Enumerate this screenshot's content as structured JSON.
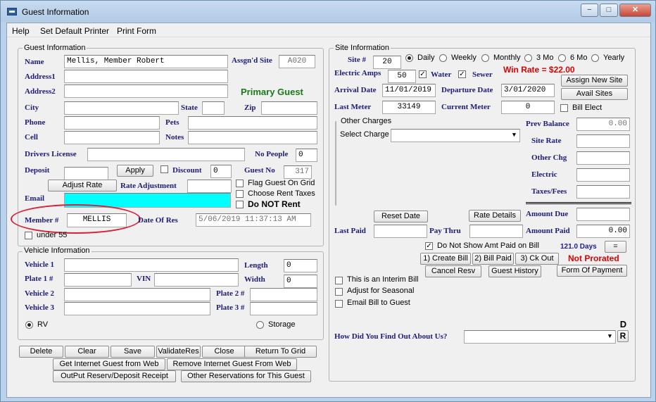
{
  "window": {
    "title": "Guest Information",
    "minimize": "−",
    "maximize": "□",
    "close": "✕"
  },
  "menu": [
    "Help",
    "Set Default Printer",
    "Print Form"
  ],
  "guest": {
    "legend": "Guest Information",
    "name_label": "Name",
    "name_value": "Mellis, Member Robert",
    "assgnd_site_label": "Assgn'd Site",
    "assgnd_site_value": "A020",
    "address1_label": "Address1",
    "address2_label": "Address2",
    "primary_guest": "Primary Guest",
    "city_label": "City",
    "state_label": "State",
    "zip_label": "Zip",
    "phone_label": "Phone",
    "pets_label": "Pets",
    "cell_label": "Cell",
    "notes_label": "Notes",
    "drivers_license_label": "Drivers License",
    "no_people_label": "No People",
    "no_people_value": "0",
    "deposit_label": "Deposit",
    "apply_button": "Apply",
    "discount_label": "Discount",
    "discount_value": "0",
    "guest_no_label": "Guest No",
    "guest_no_value": "317",
    "adjust_rate_button": "Adjust Rate",
    "rate_adjustment_label": "Rate Adjustment",
    "flag_guest_label": "Flag Guest On Grid",
    "choose_rent_taxes_label": "Choose Rent Taxes",
    "do_not_rent_label": "Do NOT Rent",
    "email_label": "Email",
    "member_label": "Member #",
    "member_value": "MELLIS",
    "date_of_res_label": "Date Of Res",
    "date_of_res_value": "5/06/2019 11:37:13 AM",
    "under55_label": "under 55",
    "accent_color": "#00ffff",
    "circle_color": "#d9203a"
  },
  "vehicle": {
    "legend": "Vehicle Information",
    "vehicle1_label": "Vehicle 1",
    "length_label": "Length",
    "length_value": "0",
    "plate1_label": "Plate 1 #",
    "vin_label": "VIN",
    "width_label": "Width",
    "width_value": "0",
    "vehicle2_label": "Vehicle 2",
    "plate2_label": "Plate 2 #",
    "vehicle3_label": "Vehicle 3",
    "plate3_label": "Plate 3 #",
    "rv_label": "RV",
    "storage_label": "Storage"
  },
  "site": {
    "legend": "Site Information",
    "site_label": "Site #",
    "site_value": "20",
    "daily": "Daily",
    "weekly": "Weekly",
    "monthly": "Monthly",
    "three_mo": "3 Mo",
    "six_mo": "6 Mo",
    "yearly": "Yearly",
    "electric_amps_label": "Electric Amps",
    "electric_amps_value": "50",
    "water_label": "Water",
    "sewer_label": "Sewer",
    "win_rate": "Win Rate = $22.00",
    "assign_new_site_button": "Assign New Site",
    "arrival_date_label": "Arrival Date",
    "arrival_date_value": "11/01/2019",
    "departure_date_label": "Departure Date",
    "departure_date_value": "3/01/2020",
    "avail_sites_button": "Avail Sites",
    "last_meter_label": "Last Meter",
    "last_meter_value": "33149",
    "current_meter_label": "Current Meter",
    "current_meter_value": "0",
    "bill_elect_label": "Bill Elect",
    "other_charges_legend": "Other Charges",
    "select_charge_label": "Select Charge",
    "prev_balance_label": "Prev Balance",
    "prev_balance_value": "0.00",
    "site_rate_label": "Site Rate",
    "other_chg_label": "Other Chg",
    "electric_label": "Electric",
    "taxes_fees_label": "Taxes/Fees",
    "reset_date_button": "Reset Date",
    "rate_details_button": "Rate Details",
    "amount_due_label": "Amount Due",
    "last_paid_label": "Last Paid",
    "pay_thru_label": "Pay Thru",
    "amount_paid_label": "Amount Paid",
    "amount_paid_value": "0.00",
    "do_not_show_amt_label": "Do Not Show Amt Paid on Bill",
    "days": "121.0 Days",
    "equals_button": "=",
    "create_bill_button": "1) Create Bill",
    "bill_paid_button": "2) Bill Paid",
    "ck_out_button": "3) Ck Out",
    "not_prorated": "Not Prorated",
    "cancel_resv_button": "Cancel Resv",
    "guest_history_button": "Guest History",
    "form_of_payment_button": "Form Of Payment",
    "interim_bill_label": "This is an Interim Bill",
    "adjust_seasonal_label": "Adjust for Seasonal",
    "email_bill_label": "Email Bill to Guest",
    "how_did_label": "How Did You Find Out About Us?",
    "d_button": "D",
    "r_button": "R"
  },
  "bottom": {
    "delete": "Delete",
    "clear": "Clear",
    "save": "Save",
    "validate_res": "ValidateRes",
    "close": "Close",
    "return_to_grid": "Return To Grid",
    "get_internet": "Get Internet Guest from Web",
    "remove_internet": "Remove Internet Guest From Web",
    "output_receipt": "OutPut Reserv/Deposit Receipt",
    "other_reservations": "Other Reservations for This Guest"
  }
}
